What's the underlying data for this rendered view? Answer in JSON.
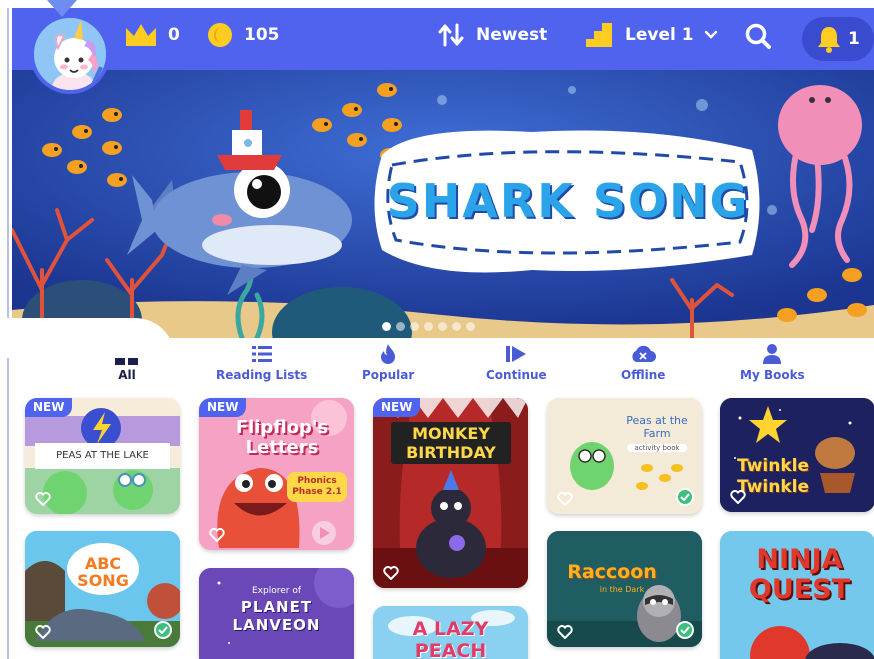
{
  "header": {
    "crowns": "0",
    "coins": "105",
    "sort_label": "Newest",
    "level_label": "Level 1",
    "notifications": "1"
  },
  "banner": {
    "title": "SHARK SONG",
    "slides": 7,
    "active_slide": 0
  },
  "tabs": [
    {
      "label": "All",
      "icon": "grid-icon"
    },
    {
      "label": "Reading Lists",
      "icon": "list-icon"
    },
    {
      "label": "Popular",
      "icon": "flame-icon"
    },
    {
      "label": "Continue",
      "icon": "play-icon"
    },
    {
      "label": "Offline",
      "icon": "cloud-icon"
    },
    {
      "label": "My Books",
      "icon": "person-icon"
    }
  ],
  "badge_new": "NEW",
  "books": [
    {
      "title": "PEAS AT THE LAKE",
      "new": true
    },
    {
      "title": "Flipflop's Letters",
      "subtitle": "Phonics Phase 2.1",
      "new": true
    },
    {
      "title": "MONKEY BIRTHDAY",
      "new": true
    },
    {
      "title": "Peas at the Farm",
      "subtitle": "activity book",
      "new": false
    },
    {
      "title": "Twinkle Twinkle",
      "new": false
    },
    {
      "title": "ABC SONG",
      "new": false
    },
    {
      "title": "PLANET LANVEON",
      "subtitle": "Explorer of",
      "new": false
    },
    {
      "title": "A LAZY PEACH",
      "new": false
    },
    {
      "title": "Raccoon",
      "subtitle": "in the Dark",
      "new": false
    },
    {
      "title": "NINJA QUEST",
      "new": false
    }
  ],
  "colors": {
    "brand": "#4f63ee",
    "gold": "#ffcc22",
    "check": "#3fbf7f"
  }
}
